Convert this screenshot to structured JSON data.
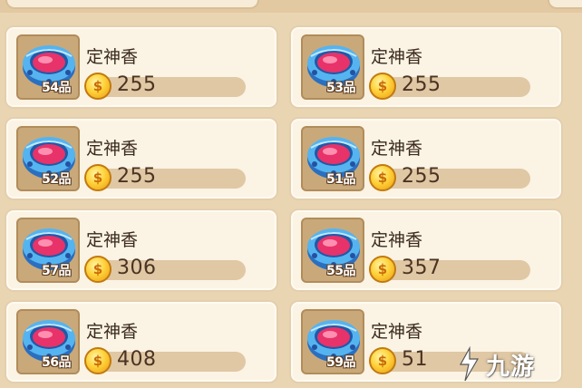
{
  "items": [
    {
      "name": "定神香",
      "grade": "54品",
      "price": "255"
    },
    {
      "name": "定神香",
      "grade": "53品",
      "price": "255"
    },
    {
      "name": "定神香",
      "grade": "52品",
      "price": "255"
    },
    {
      "name": "定神香",
      "grade": "51品",
      "price": "255"
    },
    {
      "name": "定神香",
      "grade": "57品",
      "price": "306"
    },
    {
      "name": "定神香",
      "grade": "55品",
      "price": "357"
    },
    {
      "name": "定神香",
      "grade": "56品",
      "price": "408"
    },
    {
      "name": "定神香",
      "grade": "59品",
      "price": "51"
    }
  ],
  "coin_icon": "coin-icon",
  "item_icon": "incense-bowl-icon",
  "watermark": {
    "text": "九游",
    "logo_icon": "jiuyou-logo-icon"
  },
  "colors": {
    "panel_bg": "#ead5b3",
    "card_bg": "#fbf3e4",
    "card_border": "#e3cfae",
    "icon_frame": "#c9a97a",
    "price_bar": "#e0c8a5",
    "coin_gold": "#ffd23a",
    "bowl_blue": "#4aa6e8",
    "bowl_pink": "#e8326a"
  }
}
